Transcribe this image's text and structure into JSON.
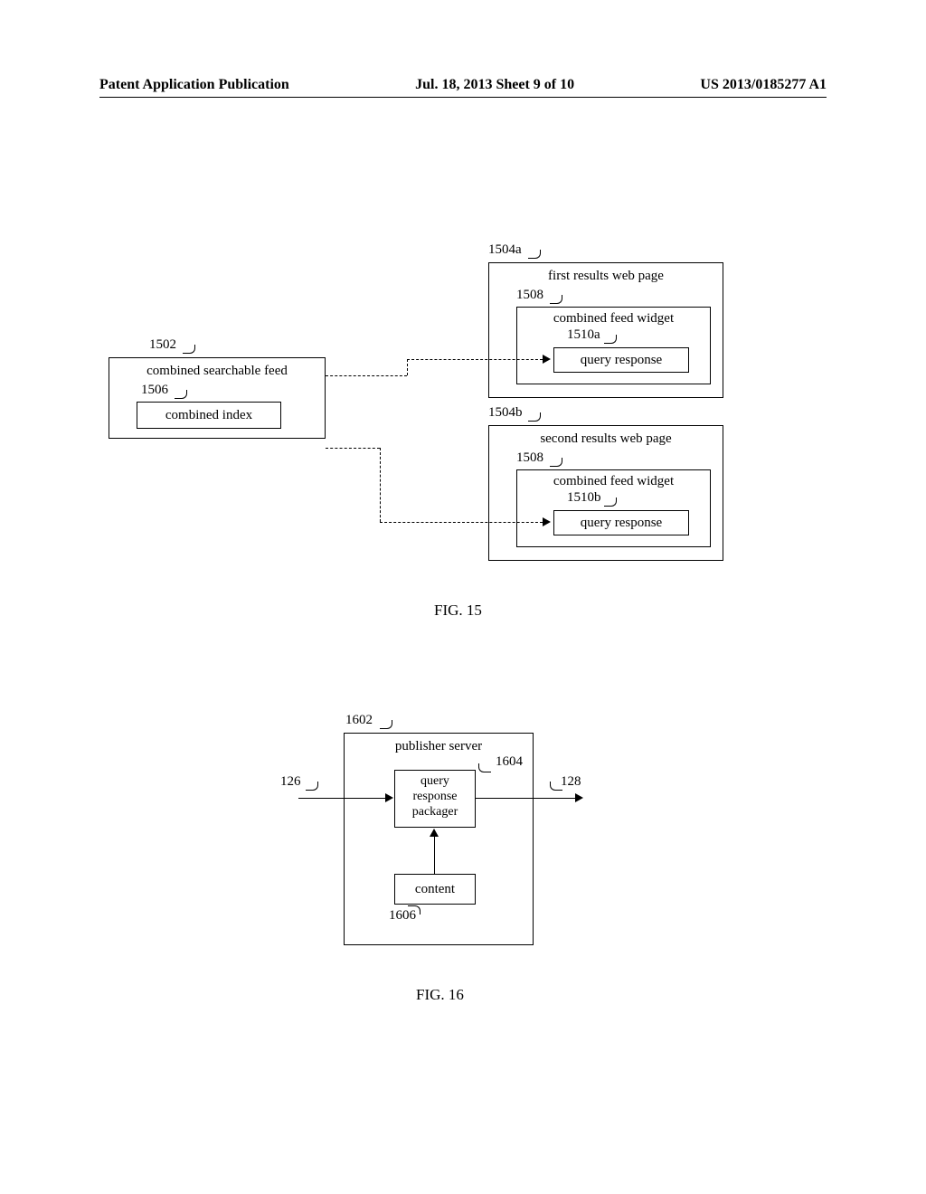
{
  "header": {
    "left": "Patent Application Publication",
    "center": "Jul. 18, 2013  Sheet 9 of 10",
    "right": "US 2013/0185277 A1"
  },
  "fig15": {
    "caption": "FIG. 15",
    "refs": {
      "r1502": "1502",
      "r1504a": "1504a",
      "r1504b": "1504b",
      "r1506": "1506",
      "r1508": "1508",
      "r1510a": "1510a",
      "r1510b": "1510b"
    },
    "csf_label": "combined searchable feed",
    "combined_index": "combined index",
    "frwp_label": "first results web page",
    "srwp_label": "second results web page",
    "cfw_label": "combined feed widget",
    "qr_label": "query response"
  },
  "fig16": {
    "caption": "FIG. 16",
    "refs": {
      "r1602": "1602",
      "r1604": "1604",
      "r1606": "1606",
      "r126": "126",
      "r128": "128"
    },
    "ps_label": "publisher server",
    "qrp_line1": "query",
    "qrp_line2": "response",
    "qrp_line3": "packager",
    "content_label": "content"
  }
}
